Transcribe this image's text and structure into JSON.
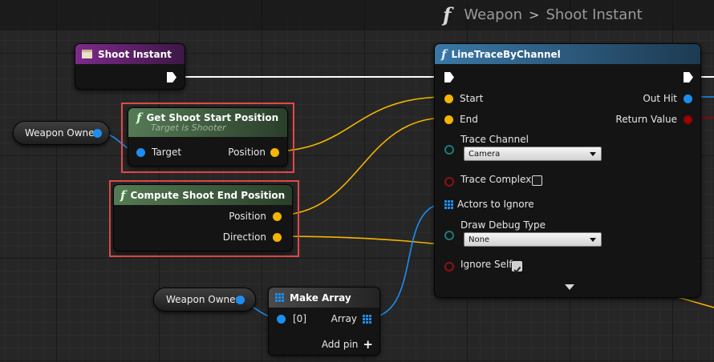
{
  "breadcrumb": {
    "function_icon": "function-icon",
    "blueprint": "Weapon",
    "separator": ">",
    "function": "Shoot Instant"
  },
  "event_node": {
    "title": "Shoot Instant"
  },
  "get_start_node": {
    "title": "Get Shoot Start Position",
    "subtitle": "Target is Shooter",
    "target_label": "Target",
    "position_label": "Position"
  },
  "compute_end_node": {
    "title": "Compute Shoot End Position",
    "position_label": "Position",
    "direction_label": "Direction"
  },
  "weapon_owner_1": {
    "label": "Weapon Owner"
  },
  "weapon_owner_2": {
    "label": "Weapon Owner"
  },
  "make_array_node": {
    "title": "Make Array",
    "element_label": "[0]",
    "array_label": "Array",
    "add_pin_label": "Add pin",
    "add_pin_glyph": "+"
  },
  "line_trace_node": {
    "title": "LineTraceByChannel",
    "start_label": "Start",
    "end_label": "End",
    "trace_channel_label": "Trace Channel",
    "trace_channel_value": "Camera",
    "trace_complex_label": "Trace Complex",
    "trace_complex_checked": false,
    "actors_to_ignore_label": "Actors to Ignore",
    "draw_debug_type_label": "Draw Debug Type",
    "draw_debug_type_value": "None",
    "ignore_self_label": "Ignore Self",
    "ignore_self_checked": true,
    "out_hit_label": "Out Hit",
    "return_value_label": "Return Value"
  },
  "colors": {
    "event_header": "#6f1e7c",
    "function_header": "#3a5a3a",
    "line_trace_header": "#2d5e80",
    "exec_wire": "#ffffff",
    "vector_wire": "#f4b400",
    "object_wire": "#1b8ef0",
    "highlight": "#e34848"
  }
}
